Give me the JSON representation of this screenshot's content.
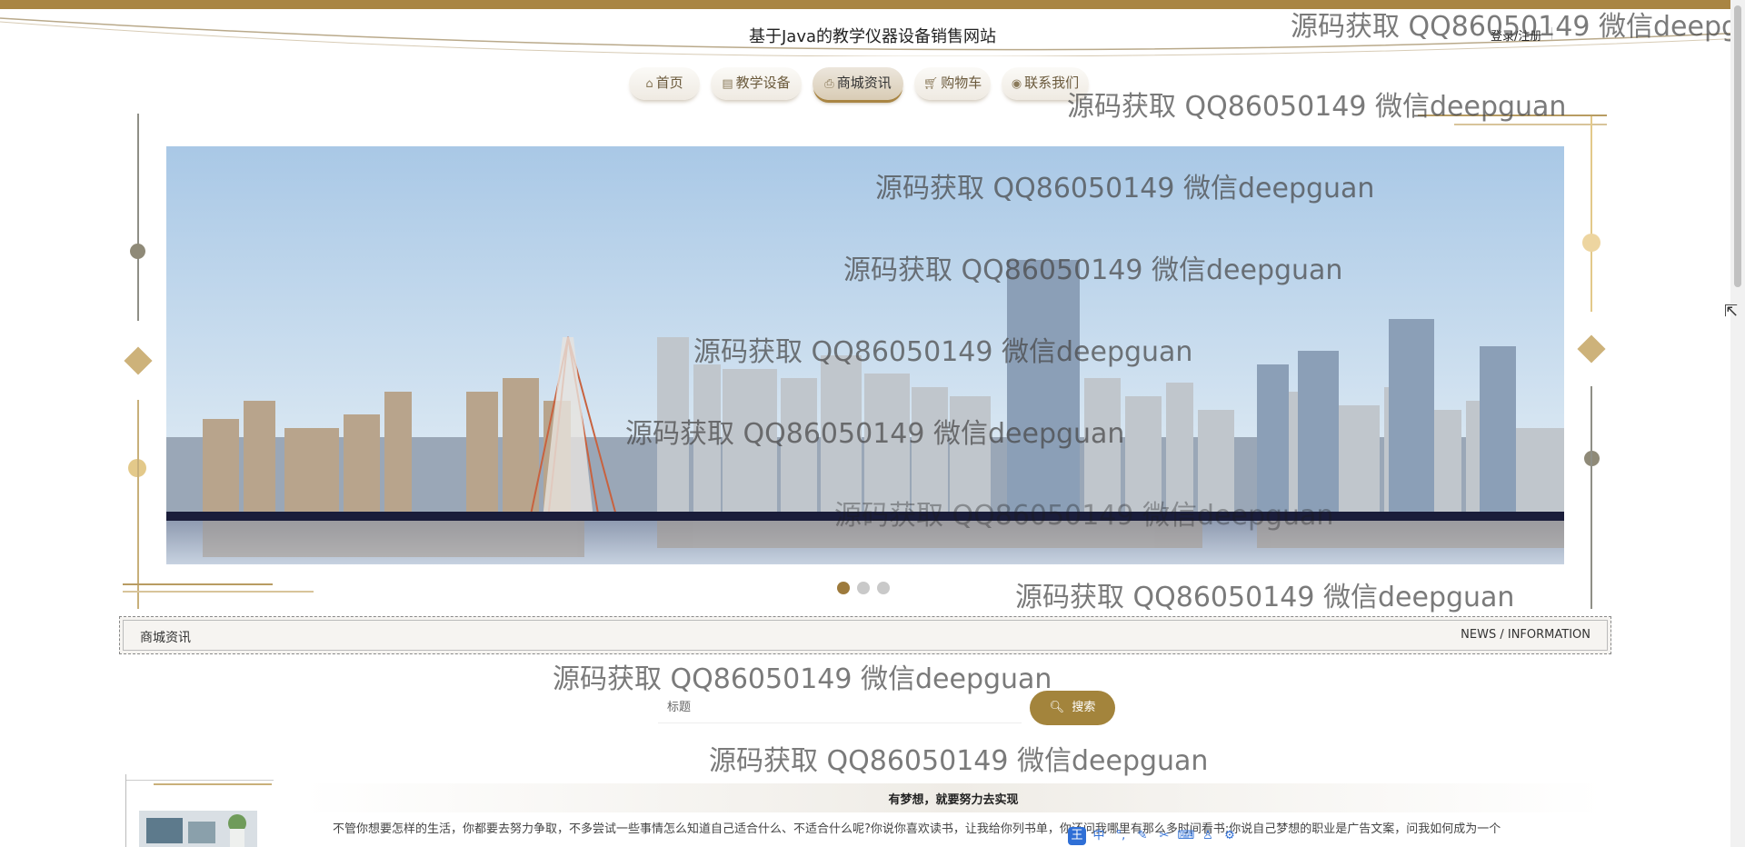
{
  "header": {
    "site_title": "基于Java的教学仪器设备销售网站",
    "login_label": "登录/注册"
  },
  "nav": {
    "items": [
      {
        "label": "首页",
        "icon": "home-icon"
      },
      {
        "label": "教学设备",
        "icon": "list-icon"
      },
      {
        "label": "商城资讯",
        "icon": "news-icon",
        "active": true
      },
      {
        "label": "购物车",
        "icon": "cart-icon"
      },
      {
        "label": "联系我们",
        "icon": "contact-icon"
      }
    ]
  },
  "carousel": {
    "slides": 3,
    "active_index": 0
  },
  "section": {
    "title": "商城资讯",
    "subtitle_en": "NEWS / INFORMATION"
  },
  "search": {
    "placeholder": "标题",
    "button_label": "搜索"
  },
  "article": {
    "title": "有梦想，就要努力去实现",
    "excerpt": "不管你想要怎样的生活，你都要去努力争取，不多尝试一些事情怎么知道自己适合什么、不适合什么呢?你说你喜欢读书，让我给你列书单，你还问我哪里有那么多时间看书;你说自己梦想的职业是广告文案，问我如何成为一个"
  },
  "watermark_text": "源码获取 QQ86050149 微信deepguan",
  "colors": {
    "accent": "#a98543",
    "button": "#a3843c",
    "dot_active": "#9d7a3c"
  }
}
